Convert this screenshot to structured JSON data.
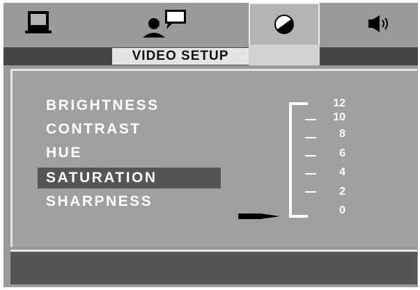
{
  "tabs": [
    {
      "name": "general",
      "icon": "monitor-icon"
    },
    {
      "name": "language",
      "icon": "speaker-person-icon"
    },
    {
      "name": "video",
      "icon": "contrast-icon",
      "active": true
    },
    {
      "name": "audio",
      "icon": "audio-icon"
    }
  ],
  "header": {
    "title": "VIDEO SETUP"
  },
  "menu": {
    "items": [
      "BRIGHTNESS",
      "CONTRAST",
      "HUE",
      "SATURATION",
      "SHARPNESS"
    ],
    "selected_index": 3
  },
  "scale": {
    "labels": [
      "12",
      "10",
      "8",
      "6",
      "4",
      "2",
      "0"
    ],
    "current_value": 0
  },
  "colors": {
    "background": "#9a9a9a",
    "highlight": "#555555",
    "text": "#ffffff"
  }
}
